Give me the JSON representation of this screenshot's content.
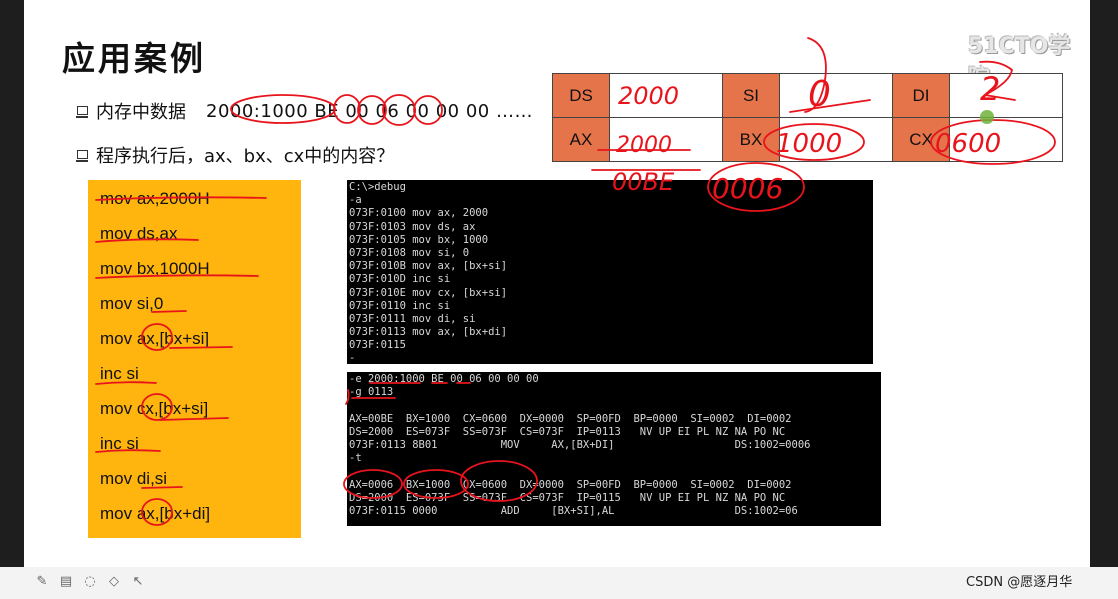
{
  "slide": {
    "title": "应用案例",
    "watermark": "51CTO学院",
    "bullet1": "内存中数据",
    "memory": "2000:1000 BE 00 06 00 00 00 ……",
    "bullet2": "程序执行后，ax、bx、cx中的内容？"
  },
  "registers": [
    {
      "name": "DS",
      "value": "2000"
    },
    {
      "name": "SI",
      "value": "0"
    },
    {
      "name": "DI",
      "value": "2"
    },
    {
      "name": "AX",
      "value": "2000"
    },
    {
      "name": "BX",
      "value": "1000"
    },
    {
      "name": "CX",
      "value": "0600"
    }
  ],
  "handwriting": {
    "ax_history": "00BE",
    "ax_final": "0006"
  },
  "code": [
    "mov ax,2000H",
    "mov ds,ax",
    "mov bx,1000H",
    "mov si,0",
    "mov ax,[bx+si]",
    "inc si",
    "mov cx,[bx+si]",
    "inc si",
    "mov di,si",
    "mov ax,[bx+di]"
  ],
  "console1": [
    "C:\\>debug",
    "-a",
    "073F:0100 mov ax, 2000",
    "073F:0103 mov ds, ax",
    "073F:0105 mov bx, 1000",
    "073F:0108 mov si, 0",
    "073F:010B mov ax, [bx+si]",
    "073F:010D inc si",
    "073F:010E mov cx, [bx+si]",
    "073F:0110 inc si",
    "073F:0111 mov di, si",
    "073F:0113 mov ax, [bx+di]",
    "073F:0115",
    "-"
  ],
  "console2": [
    "-e 2000:1000 BE 00 06 00 00 00",
    "-g 0113",
    "",
    "AX=00BE  BX=1000  CX=0600  DX=0000  SP=00FD  BP=0000  SI=0002  DI=0002",
    "DS=2000  ES=073F  SS=073F  CS=073F  IP=0113   NV UP EI PL NZ NA PO NC",
    "073F:0113 8B01          MOV     AX,[BX+DI]                   DS:1002=0006",
    "-t",
    "",
    "AX=0006  BX=1000  CX=0600  DX=0000  SP=00FD  BP=0000  SI=0002  DI=0002",
    "DS=2000  ES=073F  SS=073F  CS=073F  IP=0115   NV UP EI PL NZ NA PO NC",
    "073F:0115 0000          ADD     [BX+SI],AL                   DS:1002=06"
  ],
  "footer": {
    "credit": "CSDN @愿逐月华"
  },
  "colors": {
    "code_bg": "#ffb50d",
    "register_name_bg": "#e6744a",
    "ink": "#e8141c"
  }
}
